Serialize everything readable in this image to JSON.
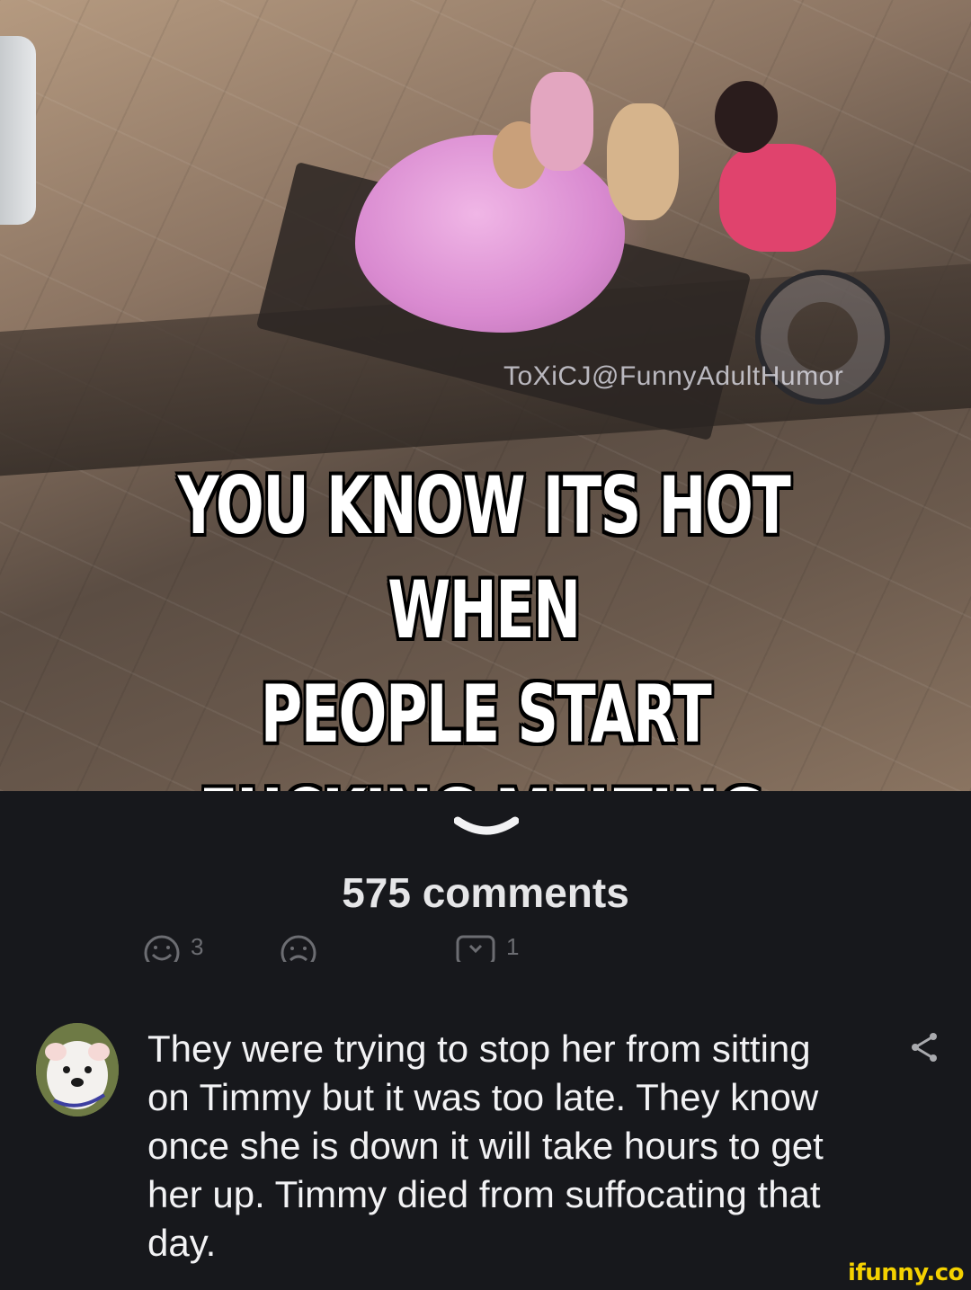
{
  "meme": {
    "watermark": "ToXiCJ@FunnyAdultHumor",
    "caption_lines": [
      "YOU KNOW ITS HOT WHEN",
      "PEOPLE START",
      "FUCKING MELTING"
    ]
  },
  "comments_header": {
    "count_label": "575 comments",
    "collapse_icon": "chevron-down-icon"
  },
  "reactions": [
    {
      "icon": "smile-face-icon",
      "count": "3"
    },
    {
      "icon": "sad-face-icon",
      "count": ""
    },
    {
      "icon": "reply-bubble-icon",
      "count": "1"
    }
  ],
  "comment": {
    "avatar_icon": "user-avatar",
    "text": "They were trying to stop her from sitting on Timmy but it was too late. They know once she is down it will take hours to get her up. Timmy died from suffocating that day.",
    "share_icon": "share-icon"
  },
  "brand": {
    "logo_text": "ifunny.co",
    "color": "#f4d100"
  },
  "colors": {
    "background": "#17181c",
    "text_primary": "#f2f2f4",
    "text_muted": "#6c6d72"
  }
}
